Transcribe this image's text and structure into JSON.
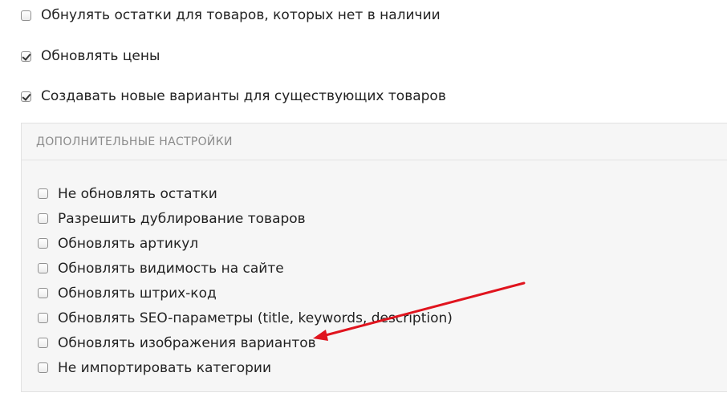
{
  "options": {
    "zero_stock": {
      "label": "Обнулять остатки для товаров, которых нет в наличии",
      "checked": false
    },
    "update_prices": {
      "label": "Обновлять цены",
      "checked": true
    },
    "create_variants": {
      "label": "Создавать новые варианты для существующих товаров",
      "checked": true
    }
  },
  "advanced": {
    "title": "ДОПОЛНИТЕЛЬНЫЕ НАСТРОЙКИ",
    "items": [
      {
        "label": "Не обновлять остатки",
        "checked": false
      },
      {
        "label": "Разрешить дублирование товаров",
        "checked": false
      },
      {
        "label": "Обновлять артикул",
        "checked": false
      },
      {
        "label": "Обновлять видимость на сайте",
        "checked": false
      },
      {
        "label": "Обновлять штрих-код",
        "checked": false
      },
      {
        "label": "Обновлять SEO-параметры (title, keywords, description)",
        "checked": false
      },
      {
        "label": "Обновлять изображения вариантов",
        "checked": false
      },
      {
        "label": "Не импортировать категории",
        "checked": false
      }
    ]
  },
  "annotation": {
    "arrow_color": "#e0141e"
  }
}
